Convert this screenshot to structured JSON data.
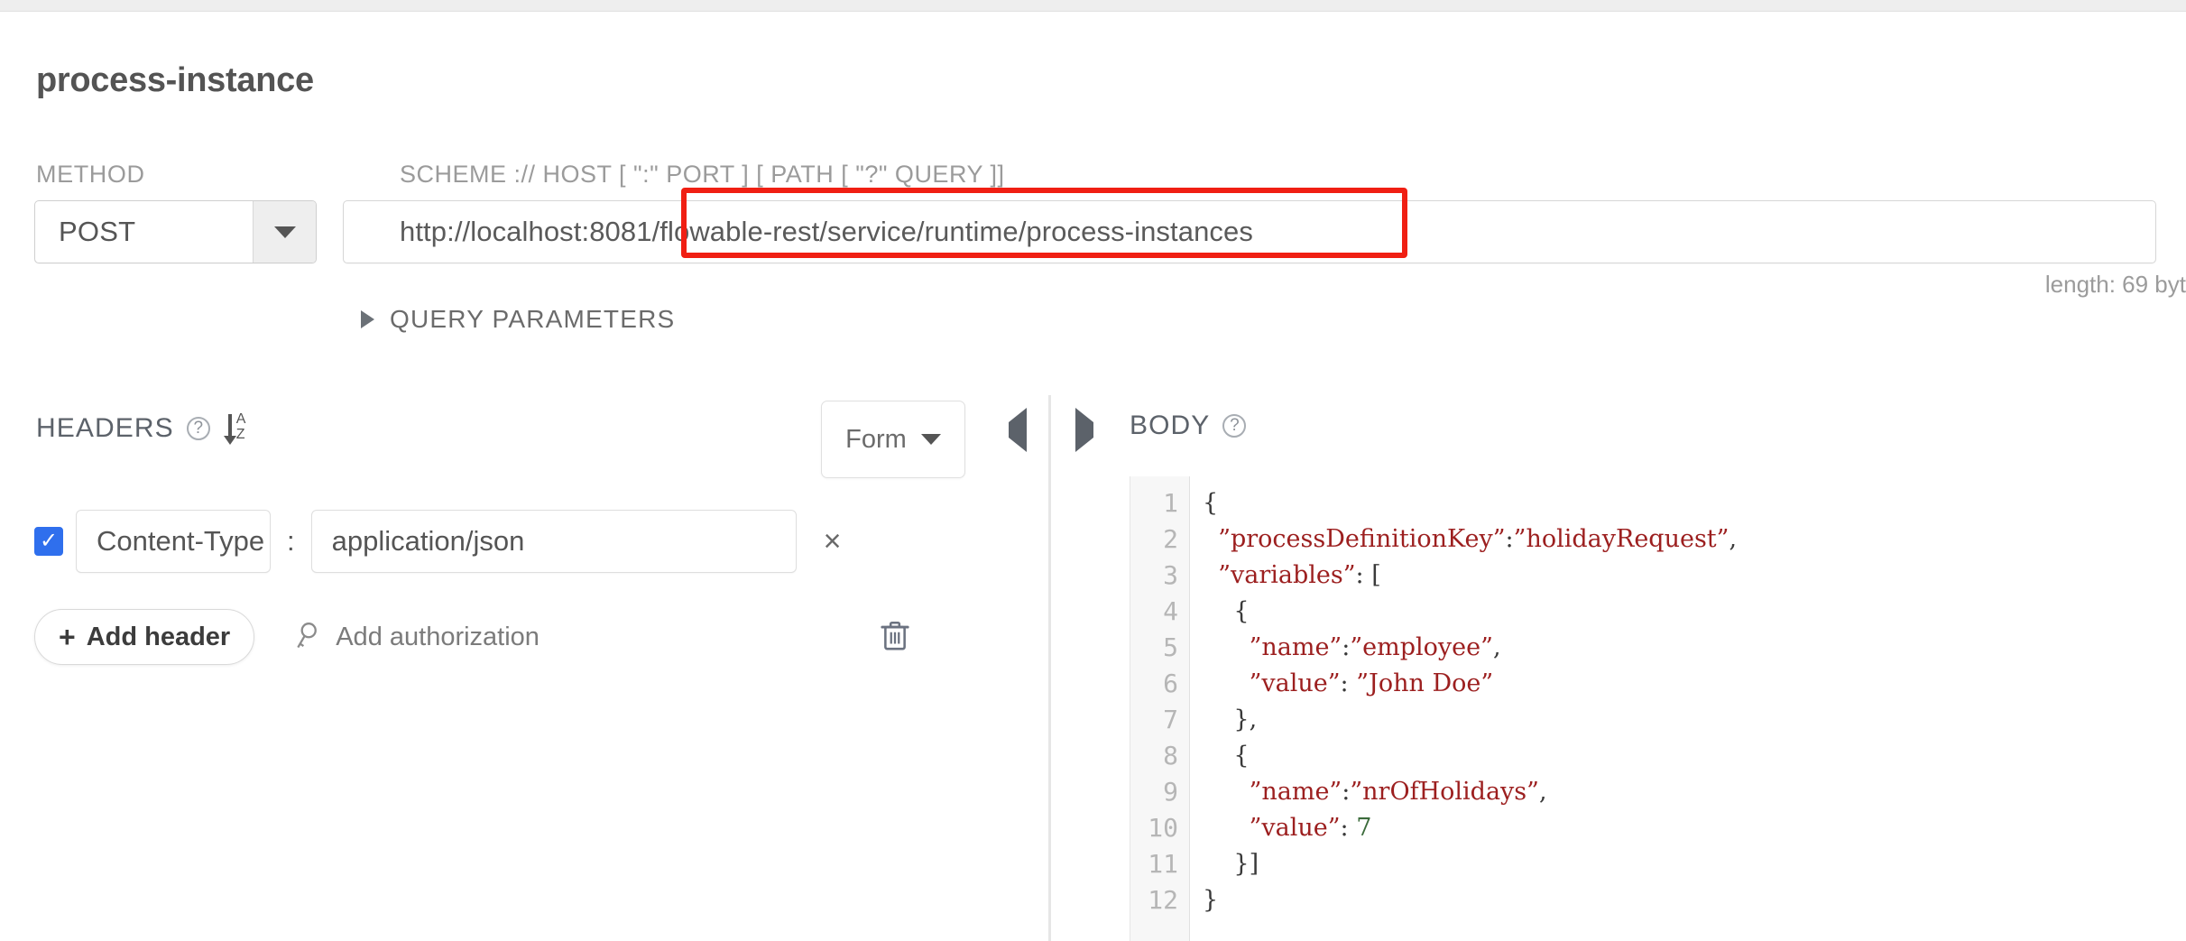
{
  "page": {
    "title": "process-instance"
  },
  "request": {
    "method_label": "METHOD",
    "method_value": "POST",
    "url_label": "SCHEME :// HOST [ \":\" PORT ] [ PATH [ \"?\" QUERY ]]",
    "url_value": "http://localhost:8081/flowable-rest/service/runtime/process-instances",
    "length_note": "length: 69 byt",
    "query_params_label": "QUERY PARAMETERS"
  },
  "headers_panel": {
    "title": "HEADERS",
    "help_icon": "help-circle-icon",
    "sort_icon": "sort-alpha-ascending-icon",
    "view_mode": "Form",
    "collapse_left_icon": "triangle-left-icon",
    "rows": [
      {
        "enabled": true,
        "name": "Content-Type",
        "separator": ":",
        "value": "application/json",
        "remove_label": "×"
      }
    ],
    "add_header_label": "Add header",
    "add_header_plus": "+",
    "add_authorization_label": "Add authorization",
    "delete_all_icon": "trash-icon"
  },
  "body_panel": {
    "title": "BODY",
    "help_icon": "help-circle-icon",
    "expand_right_icon": "triangle-right-icon",
    "line_numbers": [
      "1",
      "2",
      "3",
      "4",
      "5",
      "6",
      "7",
      "8",
      "9",
      "10",
      "11",
      "12"
    ],
    "code_lines": [
      "{",
      "  ”processDefinitionKey”:”holidayRequest”,",
      "  ”variables”: [",
      "    {",
      "      ”name”:”employee”,",
      "      ”value”: ”John Doe”",
      "    },",
      "    {",
      "      ”name”:”nrOfHolidays”,",
      "      ”value”: 7",
      "    }]",
      "}"
    ]
  },
  "colors": {
    "accent_blue": "#2f6fed",
    "highlight_red": "#f01f13",
    "string_red": "#9c1f1f",
    "number_green": "#3b6b3b",
    "label_grey": "#9b9b9b"
  }
}
